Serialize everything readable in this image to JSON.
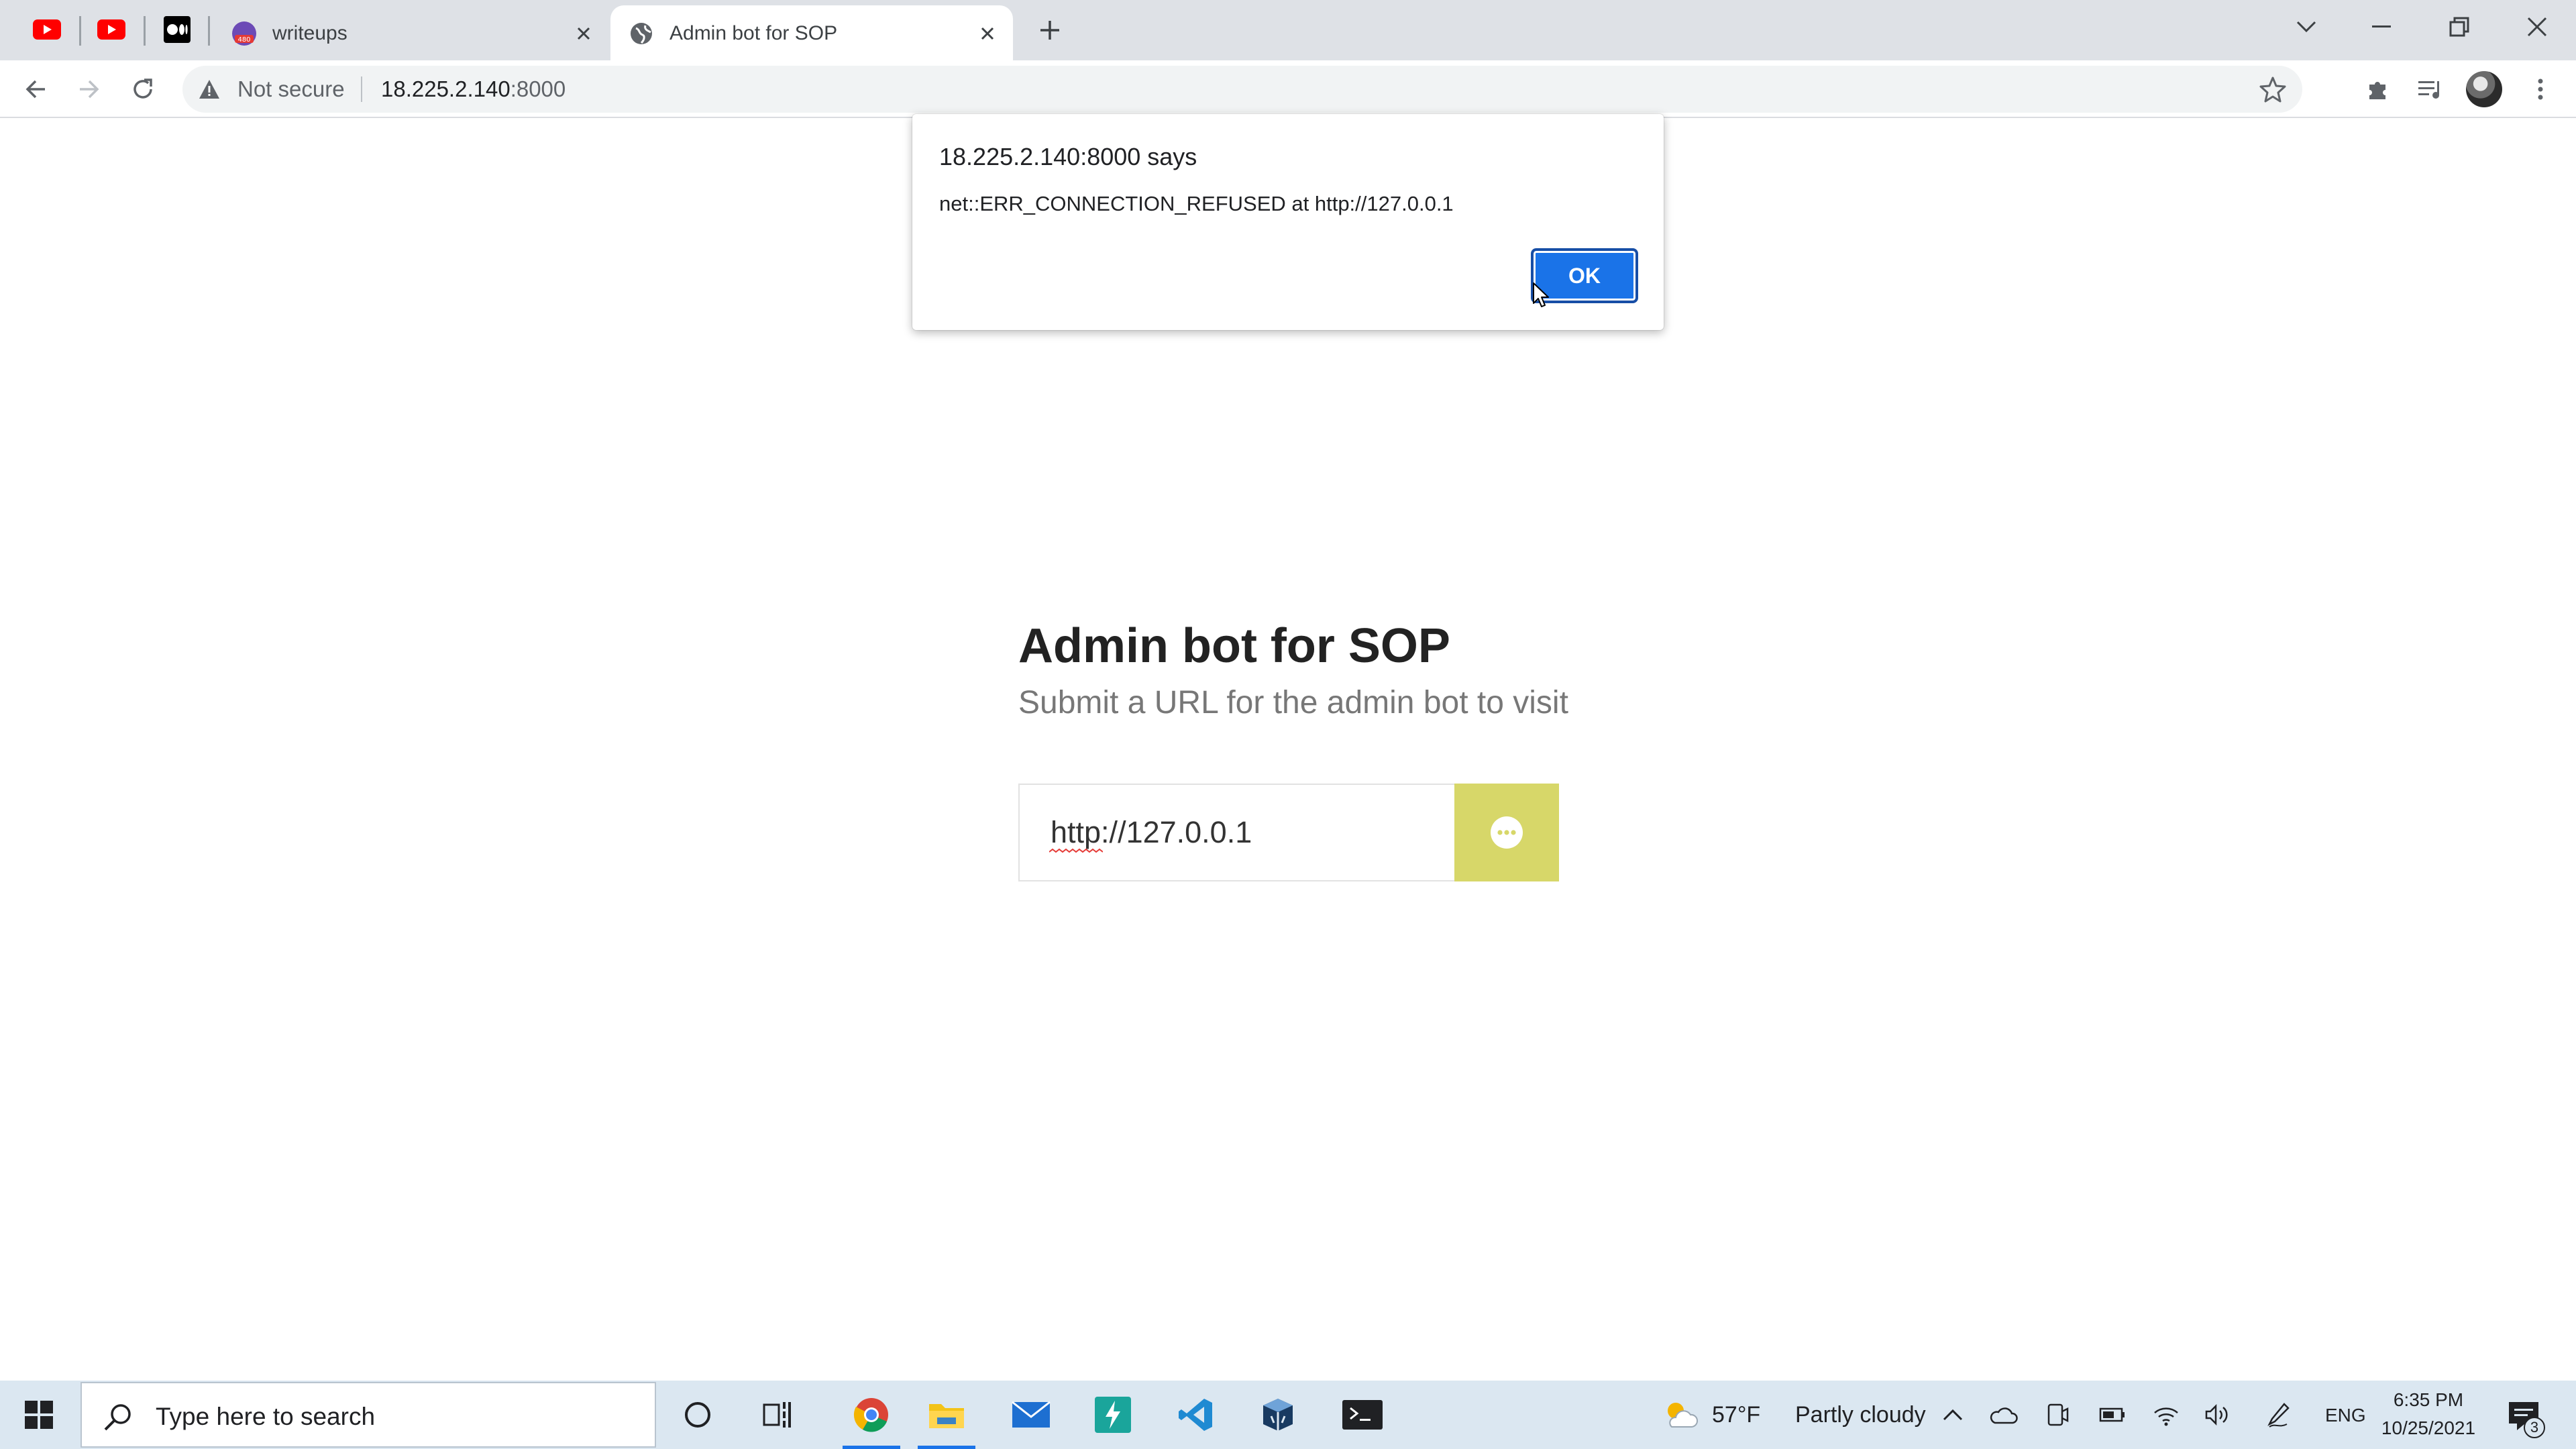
{
  "browser": {
    "tabs": [
      {
        "title": "writeups",
        "favicon_badge": "480",
        "active": false
      },
      {
        "title": "Admin bot for SOP",
        "active": true
      }
    ],
    "pinned_tabs": [
      "youtube-icon",
      "youtube-icon",
      "medium-icon"
    ],
    "address_bar": {
      "security_label": "Not secure",
      "url_host": "18.225.2.140",
      "url_port": ":8000"
    }
  },
  "dialog": {
    "title": "18.225.2.140:8000 says",
    "message": "net::ERR_CONNECTION_REFUSED at http://127.0.0.1",
    "ok_label": "OK"
  },
  "page": {
    "title": "Admin bot for SOP",
    "subtitle": "Submit a URL for the admin bot to visit",
    "url_value": "http://127.0.0.1",
    "accent_color": "#d7d769"
  },
  "taskbar": {
    "search_placeholder": "Type here to search",
    "weather": {
      "temp": "57°F",
      "desc": "Partly cloudy"
    },
    "language": "ENG",
    "clock": {
      "time": "6:35 PM",
      "date": "10/25/2021"
    },
    "notification_count": "3"
  }
}
